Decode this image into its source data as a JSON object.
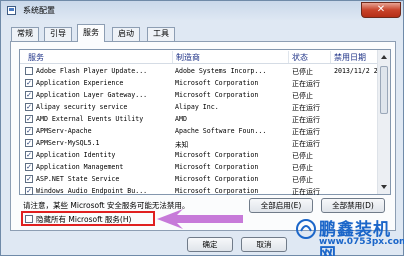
{
  "window": {
    "title": "系统配置",
    "close_glyph": "✕",
    "icon": "system-config-icon"
  },
  "tabs": [
    {
      "label": "常规"
    },
    {
      "label": "引导"
    },
    {
      "label": "服务",
      "active": true
    },
    {
      "label": "启动"
    },
    {
      "label": "工具"
    }
  ],
  "table": {
    "columns": [
      "服务",
      "制造商",
      "状态",
      "禁用日期"
    ],
    "rows": [
      {
        "checked": false,
        "name": "Adobe Flash Player Update...",
        "mfr": "Adobe Systems Incorp...",
        "status": "已停止",
        "date": "2013/11/2 2..."
      },
      {
        "checked": true,
        "name": "Application Experience",
        "mfr": "Microsoft Corporation",
        "status": "正在运行",
        "date": ""
      },
      {
        "checked": true,
        "name": "Application Layer Gateway...",
        "mfr": "Microsoft Corporation",
        "status": "已停止",
        "date": ""
      },
      {
        "checked": true,
        "name": "Alipay security service",
        "mfr": "Alipay Inc.",
        "status": "正在运行",
        "date": ""
      },
      {
        "checked": true,
        "name": "AMD External Events Utility",
        "mfr": "AMD",
        "status": "正在运行",
        "date": ""
      },
      {
        "checked": true,
        "name": "APMServ-Apache",
        "mfr": "Apache Software Foun...",
        "status": "正在运行",
        "date": ""
      },
      {
        "checked": true,
        "name": "APMServ-MySQL5.1",
        "mfr": "未知",
        "status": "正在运行",
        "date": ""
      },
      {
        "checked": true,
        "name": "Application Identity",
        "mfr": "Microsoft Corporation",
        "status": "已停止",
        "date": ""
      },
      {
        "checked": true,
        "name": "Application Management",
        "mfr": "Microsoft Corporation",
        "status": "已停止",
        "date": ""
      },
      {
        "checked": true,
        "name": "ASP.NET State Service",
        "mfr": "Microsoft Corporation",
        "status": "已停止",
        "date": ""
      },
      {
        "checked": true,
        "name": "Windows Audio Endpoint Bu...",
        "mfr": "Microsoft Corporation",
        "status": "正在运行",
        "date": ""
      }
    ]
  },
  "note": "请注意，某些 Microsoft 安全服务可能无法禁用。",
  "buttons": {
    "enable_all": "全部启用(E)",
    "disable_all": "全部禁用(D)",
    "ok": "确定",
    "cancel": "取消"
  },
  "hide_ms_label": "隐藏所有 Microsoft 服务(H)",
  "watermark": {
    "title": "鹏鑫装机网",
    "url": "www.0753px.com"
  },
  "colors": {
    "highlight_box": "#e02020",
    "pointer_arrow": "#c77ad9",
    "watermark": "#1b66c9"
  }
}
